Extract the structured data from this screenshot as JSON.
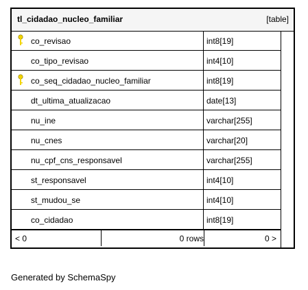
{
  "table": {
    "name": "tl_cidadao_nucleo_familiar",
    "type_label": "[table]",
    "columns": [
      {
        "name": "co_revisao",
        "type": "int8[19]",
        "key": true
      },
      {
        "name": "co_tipo_revisao",
        "type": "int4[10]",
        "key": false
      },
      {
        "name": "co_seq_cidadao_nucleo_familiar",
        "type": "int8[19]",
        "key": true
      },
      {
        "name": "dt_ultima_atualizacao",
        "type": "date[13]",
        "key": false
      },
      {
        "name": "nu_ine",
        "type": "varchar[255]",
        "key": false
      },
      {
        "name": "nu_cnes",
        "type": "varchar[20]",
        "key": false
      },
      {
        "name": "nu_cpf_cns_responsavel",
        "type": "varchar[255]",
        "key": false
      },
      {
        "name": "st_responsavel",
        "type": "int4[10]",
        "key": false
      },
      {
        "name": "st_mudou_se",
        "type": "int4[10]",
        "key": false
      },
      {
        "name": "co_cidadao",
        "type": "int8[19]",
        "key": false
      }
    ],
    "footer": {
      "parents": "< 0",
      "rows": "0 rows",
      "children": "0 >"
    }
  },
  "generated_by": "Generated by SchemaSpy",
  "colors": {
    "key_icon": "#f2d400",
    "header_bg": "#f5f5f5",
    "border": "#000000"
  }
}
